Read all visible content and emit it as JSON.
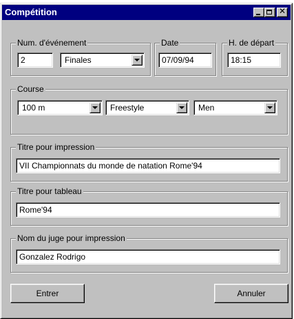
{
  "window": {
    "title": "Compétition",
    "controls": {
      "minimize_icon": "minimize-icon",
      "maximize_icon": "maximize-icon",
      "close_icon": "close-icon",
      "close_glyph": "✕"
    },
    "accent_color": "#000080",
    "face_color": "#c0c0c0"
  },
  "event": {
    "number_label": "Num. d'événement",
    "number_value": "2",
    "round_value": "Finales",
    "date_label": "Date",
    "date_value": "07/09/94",
    "start_label": "H. de départ",
    "start_value": "18:15"
  },
  "race": {
    "label": "Course",
    "distance_value": "100 m",
    "stroke_value": "Freestyle",
    "gender_value": "Men"
  },
  "print_title": {
    "label": "Titre pour impression",
    "value": "VII Championnats du monde de natation Rome'94"
  },
  "board_title": {
    "label": "Titre pour tableau",
    "value": "Rome'94"
  },
  "judge": {
    "label": "Nom du juge pour impression",
    "value": "Gonzalez Rodrigo"
  },
  "buttons": {
    "enter_label": "Entrer",
    "cancel_label": "Annuler"
  }
}
